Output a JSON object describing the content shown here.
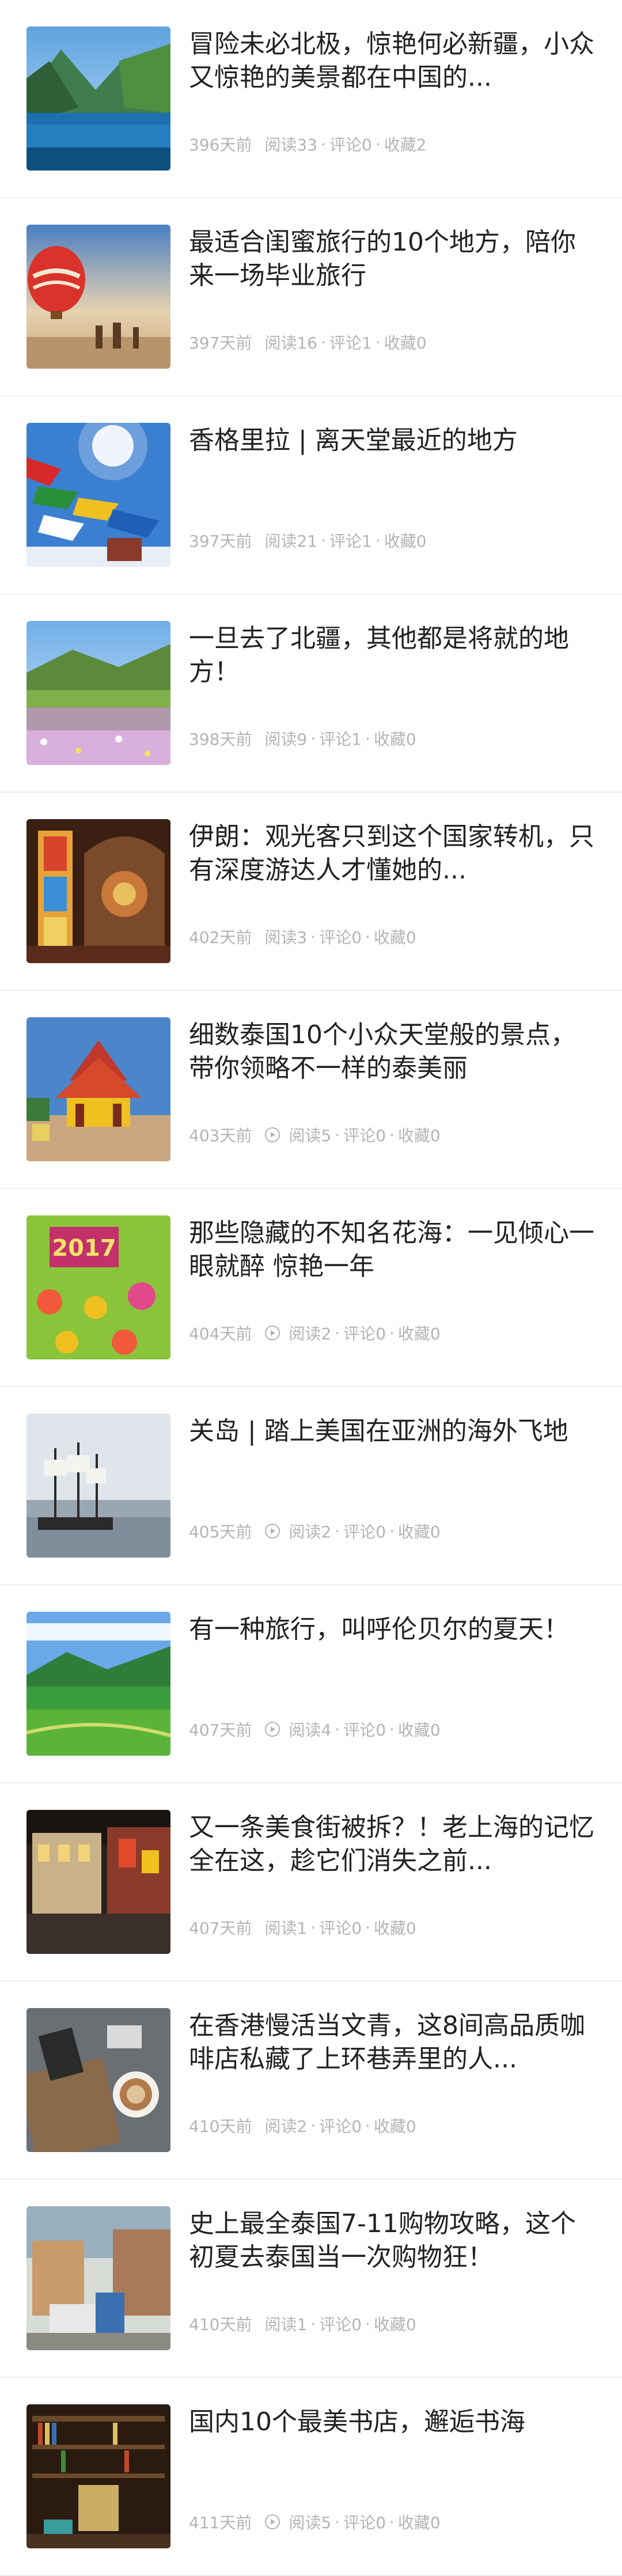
{
  "articles": [
    {
      "title": "冒险未必北极，惊艳何必新疆，小众又惊艳的美景都在中国的...",
      "date": "396天前",
      "reads": "阅读33",
      "comments": "评论0",
      "favorites": "收藏2",
      "video": false,
      "thumb": "lake-mountains"
    },
    {
      "title": "最适合闺蜜旅行的10个地方，陪你来一场毕业旅行",
      "date": "397天前",
      "reads": "阅读16",
      "comments": "评论1",
      "favorites": "收藏0",
      "video": false,
      "thumb": "hot-air-balloon"
    },
    {
      "title": "香格里拉 | 离天堂最近的地方",
      "date": "397天前",
      "reads": "阅读21",
      "comments": "评论1",
      "favorites": "收藏0",
      "video": false,
      "thumb": "prayer-flags"
    },
    {
      "title": "一旦去了北疆，其他都是将就的地方！",
      "date": "398天前",
      "reads": "阅读9",
      "comments": "评论1",
      "favorites": "收藏0",
      "video": false,
      "thumb": "flower-meadow"
    },
    {
      "title": "伊朗：观光客只到这个国家转机，只有深度游达人才懂她的...",
      "date": "402天前",
      "reads": "阅读3",
      "comments": "评论0",
      "favorites": "收藏0",
      "video": false,
      "thumb": "stained-glass"
    },
    {
      "title": "细数泰国10个小众天堂般的景点，带你领略不一样的泰美丽",
      "date": "403天前",
      "reads": "阅读5",
      "comments": "评论0",
      "favorites": "收藏0",
      "video": true,
      "thumb": "thai-pavilion"
    },
    {
      "title": "那些隐藏的不知名花海：一见倾心一眼就醉 惊艳一年",
      "date": "404天前",
      "reads": "阅读2",
      "comments": "评论0",
      "favorites": "收藏0",
      "video": true,
      "thumb": "flower-2017"
    },
    {
      "title": "关岛 | 踏上美国在亚洲的海外飞地",
      "date": "405天前",
      "reads": "阅读2",
      "comments": "评论0",
      "favorites": "收藏0",
      "video": true,
      "thumb": "sailing-ship"
    },
    {
      "title": "有一种旅行，叫呼伦贝尔的夏天！",
      "date": "407天前",
      "reads": "阅读4",
      "comments": "评论0",
      "favorites": "收藏0",
      "video": true,
      "thumb": "grassland"
    },
    {
      "title": "又一条美食街被拆？！老上海的记忆全在这，趁它们消失之前...",
      "date": "407天前",
      "reads": "阅读1",
      "comments": "评论0",
      "favorites": "收藏0",
      "video": false,
      "thumb": "street-night"
    },
    {
      "title": "在香港慢活当文青，这8间高品质咖啡店私藏了上环巷弄里的人...",
      "date": "410天前",
      "reads": "阅读2",
      "comments": "评论0",
      "favorites": "收藏0",
      "video": false,
      "thumb": "coffee-table"
    },
    {
      "title": "史上最全泰国7-11购物攻略，这个初夏去泰国当一次购物狂！",
      "date": "410天前",
      "reads": "阅读1",
      "comments": "评论0",
      "favorites": "收藏0",
      "video": false,
      "thumb": "market-street"
    },
    {
      "title": "国内10个最美书店，邂逅书海",
      "date": "411天前",
      "reads": "阅读5",
      "comments": "评论0",
      "favorites": "收藏0",
      "video": true,
      "thumb": "bookstore"
    }
  ],
  "colors": {
    "title": "#222222",
    "meta": "#b4b4b4",
    "divider": "#eeeeee",
    "background": "#ffffff"
  }
}
